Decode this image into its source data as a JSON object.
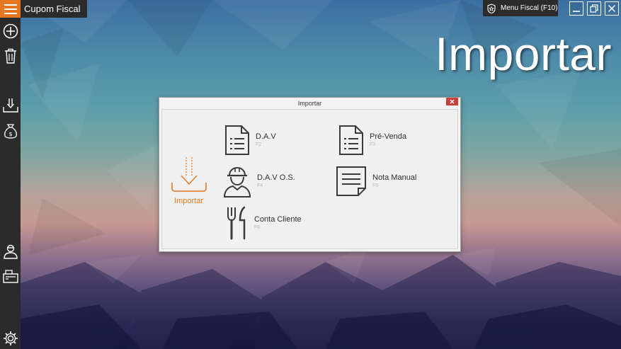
{
  "window": {
    "title": "Cupom Fiscal"
  },
  "topbar": {
    "menu_fiscal_label": "Menu Fiscal (F10)"
  },
  "page": {
    "heading": "Importar"
  },
  "sidebar": {
    "items": [
      {
        "icon": "add-icon"
      },
      {
        "icon": "trash-icon"
      },
      {
        "icon": "download-icon"
      },
      {
        "icon": "money-bag-icon"
      },
      {
        "icon": "user-icon"
      },
      {
        "icon": "cash-register-icon"
      },
      {
        "icon": "gear-icon"
      }
    ]
  },
  "dialog": {
    "title": "Importar",
    "side_label": "Importar",
    "options": [
      {
        "label": "D.A.V",
        "shortcut": "F2",
        "icon": "document-list-icon"
      },
      {
        "label": "Pré-Venda",
        "shortcut": "F3",
        "icon": "document-list-icon"
      },
      {
        "label": "D.A.V O.S.",
        "shortcut": "F4",
        "icon": "worker-icon"
      },
      {
        "label": "Nota Manual",
        "shortcut": "F6",
        "icon": "note-icon"
      },
      {
        "label": "Conta Cliente",
        "shortcut": "F8",
        "icon": "cutlery-icon"
      }
    ]
  },
  "colors": {
    "accent": "#e4761f",
    "sidebar": "#2b2b2b",
    "close": "#c8413a"
  }
}
